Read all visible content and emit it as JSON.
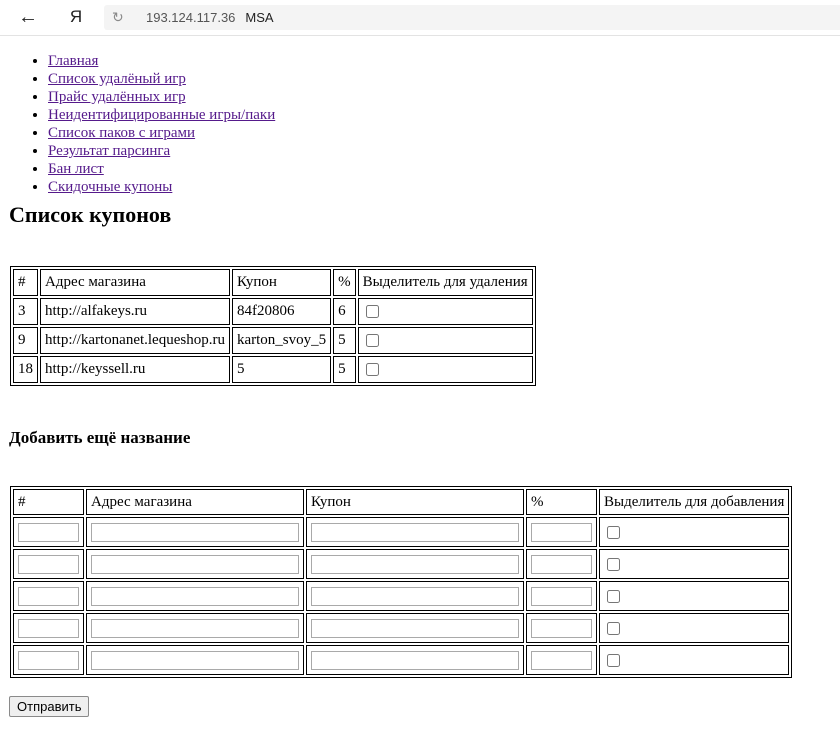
{
  "browser": {
    "back_icon": "←",
    "yandex_icon": "Я",
    "reload_icon": "↻",
    "url": "193.124.117.36",
    "page_title": "MSA"
  },
  "nav": {
    "items": [
      "Главная",
      "Список удалёный игр",
      "Прайс удалённых игр",
      "Неидентифицированные игры/паки",
      "Список паков с играми",
      "Результат парсинга",
      "Бан лист",
      "Скидочные купоны"
    ]
  },
  "coupons": {
    "title": "Список купонов",
    "headers": [
      "#",
      "Адрес магазина",
      "Купон",
      "%",
      "Выделитель для удаления"
    ],
    "rows": [
      {
        "id": "3",
        "shop": "http://alfakeys.ru",
        "coupon": "84f20806",
        "percent": "6"
      },
      {
        "id": "9",
        "shop": "http://kartonanet.lequeshop.ru",
        "coupon": "karton_svoy_5",
        "percent": "5"
      },
      {
        "id": "18",
        "shop": "http://keyssell.ru",
        "coupon": "5",
        "percent": "5"
      }
    ]
  },
  "add_form": {
    "title": "Добавить ещё название",
    "headers": [
      "#",
      "Адрес магазина",
      "Купон",
      "%",
      "Выделитель для добавления"
    ],
    "submit_label": "Отправить"
  }
}
